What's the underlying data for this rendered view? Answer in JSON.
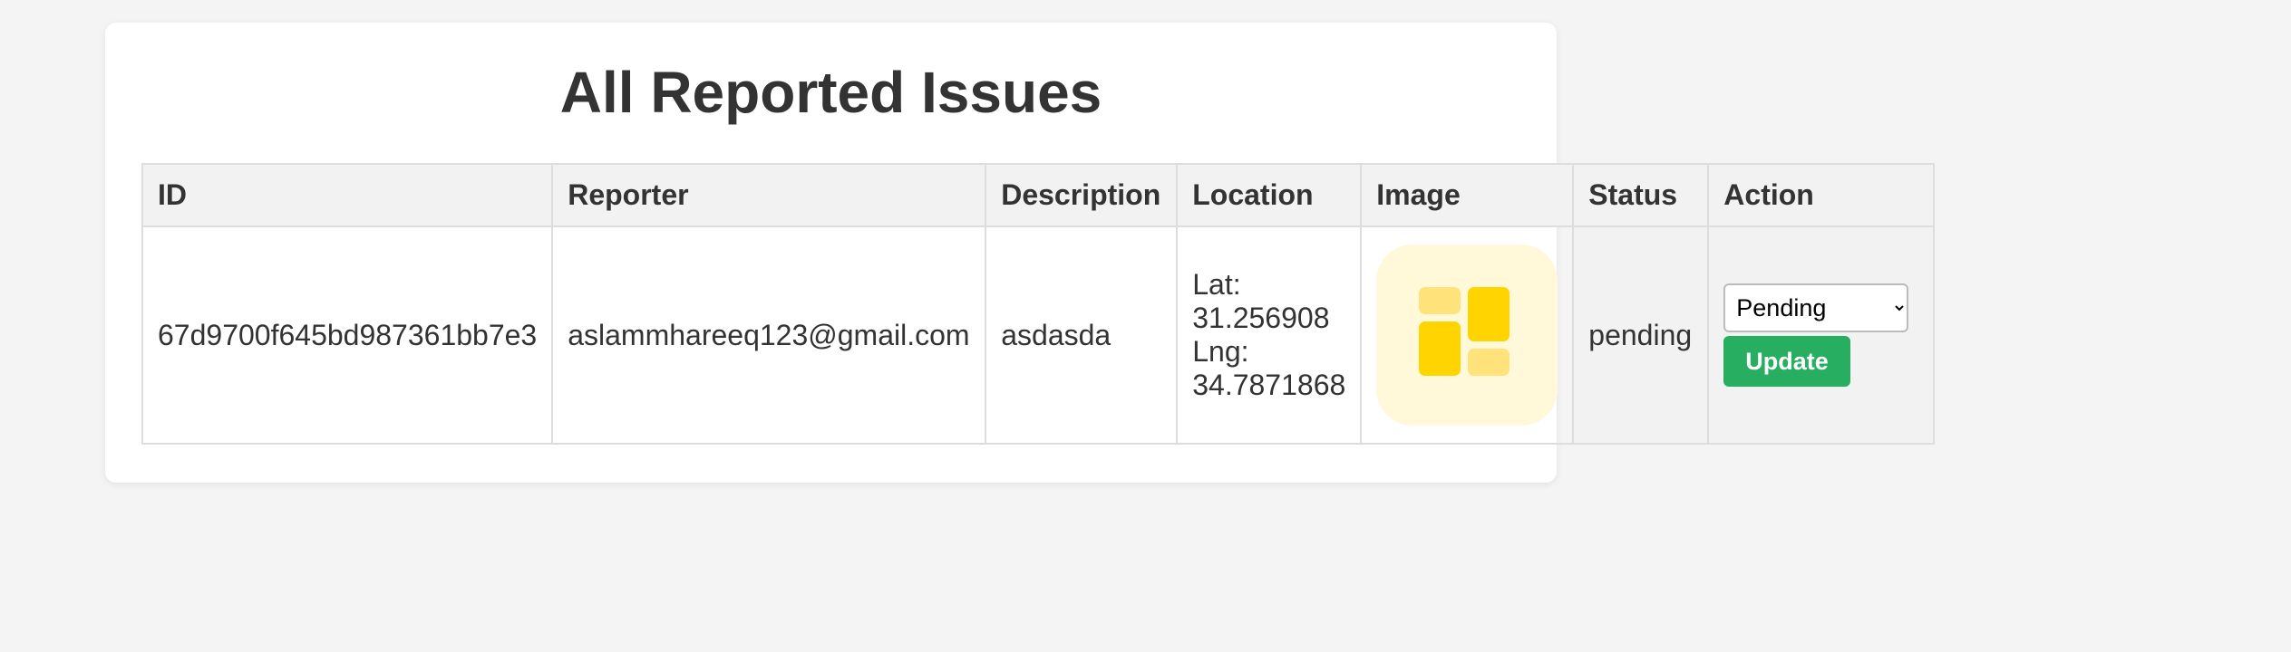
{
  "page": {
    "title": "All Reported Issues"
  },
  "table": {
    "headers": [
      "ID",
      "Reporter",
      "Description",
      "Location",
      "Image",
      "Status",
      "Action"
    ],
    "rows": [
      {
        "id": "67d9700f645bd987361bb7e3",
        "reporter": "aslammhareeq123@gmail.com",
        "description": "asdasda",
        "location": {
          "lat_label": "Lat:",
          "lat": "31.256908",
          "lng_label": "Lng:",
          "lng": "34.7871868"
        },
        "image_icon": "image-placeholder-icon",
        "status": "pending",
        "action": {
          "select_value": "Pending",
          "update_label": "Update"
        }
      }
    ]
  },
  "colors": {
    "background": "#f4f4f4",
    "card": "#ffffff",
    "header_bg": "#f2f2f2",
    "update_button": "#27ae60",
    "image_thumb_bg": "#fff8d9",
    "image_icon": "#ffd400"
  }
}
